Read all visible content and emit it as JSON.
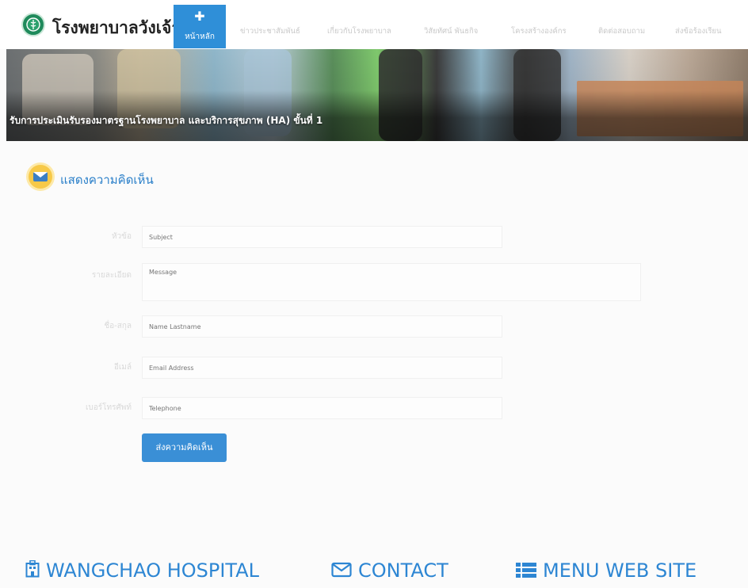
{
  "header": {
    "brand": "โรงพยาบาลวังเจ้า",
    "home": {
      "icon": "plus-icon",
      "label": "หน้าหลัก"
    },
    "nav": [
      {
        "label": "ข่าวประชาสัมพันธ์"
      },
      {
        "label": "เกี่ยวกับโรงพยาบาล"
      },
      {
        "label": "วิสัยทัศน์ พันธกิจ"
      },
      {
        "label": "โครงสร้างองค์กร"
      },
      {
        "label": "ติดต่อสอบถาม"
      },
      {
        "label": "ส่งข้อร้องเรียน"
      }
    ]
  },
  "banner": {
    "caption": "รับการประเมินรับรองมาตรฐานโรงพยาบาล และบริการสุขภาพ (HA) ขั้นที่ 1"
  },
  "section": {
    "icon": "mail-icon",
    "title": "แสดงความคิดเห็น"
  },
  "form": {
    "fields": [
      {
        "label": "หัวข้อ",
        "placeholder": "Subject"
      },
      {
        "label": "รายละเอียด",
        "placeholder": "Message"
      },
      {
        "label": "ชื่อ-สกุล",
        "placeholder": "Name Lastname"
      },
      {
        "label": "อีเมล์",
        "placeholder": "Email Address"
      },
      {
        "label": "เบอร์โทรศัพท์",
        "placeholder": "Telephone"
      }
    ],
    "submit": "ส่งความคิดเห็น"
  },
  "footer": [
    {
      "icon": "hospital-icon",
      "label": "WANGCHAO HOSPITAL"
    },
    {
      "icon": "envelope-icon",
      "label": "CONTACT"
    },
    {
      "icon": "list-icon",
      "label": "MENU WEB SITE"
    }
  ],
  "colors": {
    "accent": "#2f8fd8",
    "brand_green": "#1f8a5b",
    "link": "#2d86d3"
  }
}
